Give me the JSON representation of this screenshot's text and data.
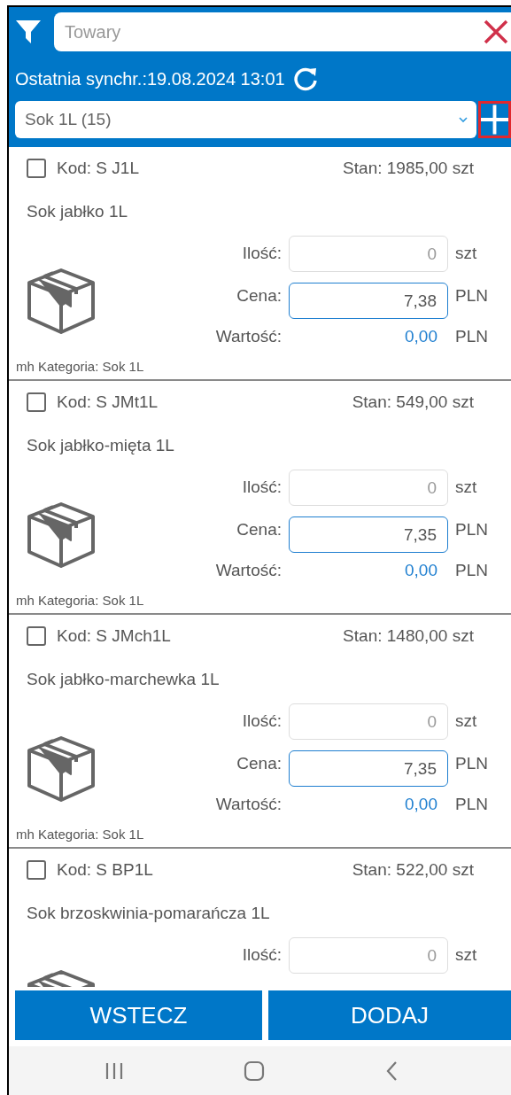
{
  "header": {
    "search": {
      "placeholder": "Towary"
    },
    "sync_text": "Ostatnia synchr.:19.08.2024 13:01",
    "category_select": {
      "value": "Sok 1L (15)"
    },
    "add_button": {
      "highlighted": true
    }
  },
  "products": [
    {
      "checked": false,
      "code": "Kod: S J1L",
      "stock": "Stan: 1985,00 szt",
      "name": "Sok jabłko 1L",
      "qty_label": "Ilość:",
      "qty": "0",
      "qty_unit": "szt",
      "price_label": "Cena:",
      "price": "7,38",
      "price_unit": "PLN",
      "value_label": "Wartość:",
      "value": "0,00",
      "value_unit": "PLN",
      "category": "mh Kategoria: Sok 1L"
    },
    {
      "checked": false,
      "code": "Kod: S JMt1L",
      "stock": "Stan: 549,00 szt",
      "name": "Sok jabłko-mięta 1L",
      "qty_label": "Ilość:",
      "qty": "0",
      "qty_unit": "szt",
      "price_label": "Cena:",
      "price": "7,35",
      "price_unit": "PLN",
      "value_label": "Wartość:",
      "value": "0,00",
      "value_unit": "PLN",
      "category": "mh Kategoria: Sok 1L"
    },
    {
      "checked": false,
      "code": "Kod: S JMch1L",
      "stock": "Stan: 1480,00 szt",
      "name": "Sok jabłko-marchewka 1L",
      "qty_label": "Ilość:",
      "qty": "0",
      "qty_unit": "szt",
      "price_label": "Cena:",
      "price": "7,35",
      "price_unit": "PLN",
      "value_label": "Wartość:",
      "value": "0,00",
      "value_unit": "PLN",
      "category": "mh Kategoria: Sok 1L"
    },
    {
      "checked": false,
      "code": "Kod: S BP1L",
      "stock": "Stan: 522,00 szt",
      "name": "Sok brzoskwinia-pomarańcza 1L",
      "qty_label": "Ilość:",
      "qty": "0",
      "qty_unit": "szt"
    }
  ],
  "buttons": [
    {
      "label": "WSTECZ"
    },
    {
      "label": "DODAJ"
    }
  ]
}
